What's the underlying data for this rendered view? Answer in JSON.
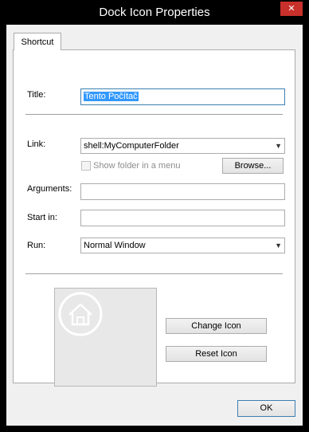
{
  "window": {
    "title": "Dock Icon Properties",
    "close_glyph": "✕"
  },
  "tabs": [
    {
      "label": "Shortcut"
    }
  ],
  "form": {
    "title_label": "Title:",
    "title_value": "Tento Počítač",
    "link_label": "Link:",
    "link_value": "shell:MyComputerFolder",
    "show_folder_label": "Show folder in a menu",
    "show_folder_checked": false,
    "browse_label": "Browse...",
    "arguments_label": "Arguments:",
    "arguments_value": "",
    "startin_label": "Start in:",
    "startin_value": "",
    "run_label": "Run:",
    "run_value": "Normal Window"
  },
  "icon_section": {
    "preview_icon": "home-icon",
    "change_label": "Change Icon",
    "reset_label": "Reset Icon"
  },
  "footer": {
    "ok_label": "OK"
  },
  "colors": {
    "selection": "#3399ff",
    "close": "#c7302b",
    "focus_border": "#3c7fb1"
  }
}
